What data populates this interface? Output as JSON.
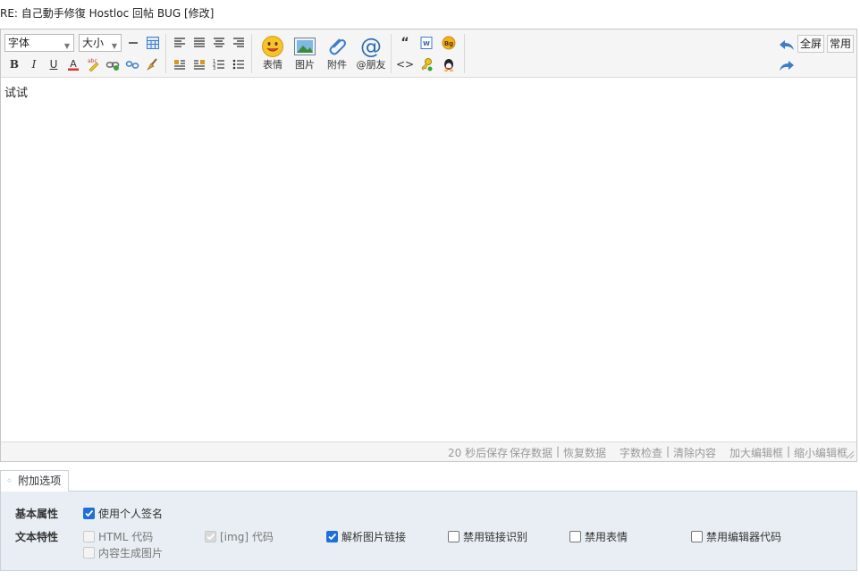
{
  "title": "RE: 自己動手修復 Hostloc 回帖 BUG [修改]",
  "toolbar": {
    "font_select": "字体",
    "size_select": "大小",
    "emoji_label": "表情",
    "image_label": "图片",
    "attach_label": "附件",
    "at_label": "@朋友",
    "fullscreen_label": "全屏",
    "common_label": "常用"
  },
  "editor": {
    "content": "试试"
  },
  "statusbar": {
    "autosave": "20 秒后保存",
    "save_data": "保存数据",
    "restore_data": "恢复数据",
    "word_check": "字数检查",
    "clear_content": "清除内容",
    "enlarge": "加大编辑框",
    "shrink": "缩小编辑框",
    "separator": "|"
  },
  "options": {
    "tab_label": "附加选项",
    "basic_label": "基本属性",
    "text_label": "文本特性",
    "use_signature": "使用个人签名",
    "html_code": "HTML 代码",
    "img_code": "[img] 代码",
    "parse_img_links": "解析图片链接",
    "disable_link_detect": "禁用链接识别",
    "disable_smilies": "禁用表情",
    "disable_editor_code": "禁用编辑器代码",
    "content_to_image": "内容生成图片"
  }
}
